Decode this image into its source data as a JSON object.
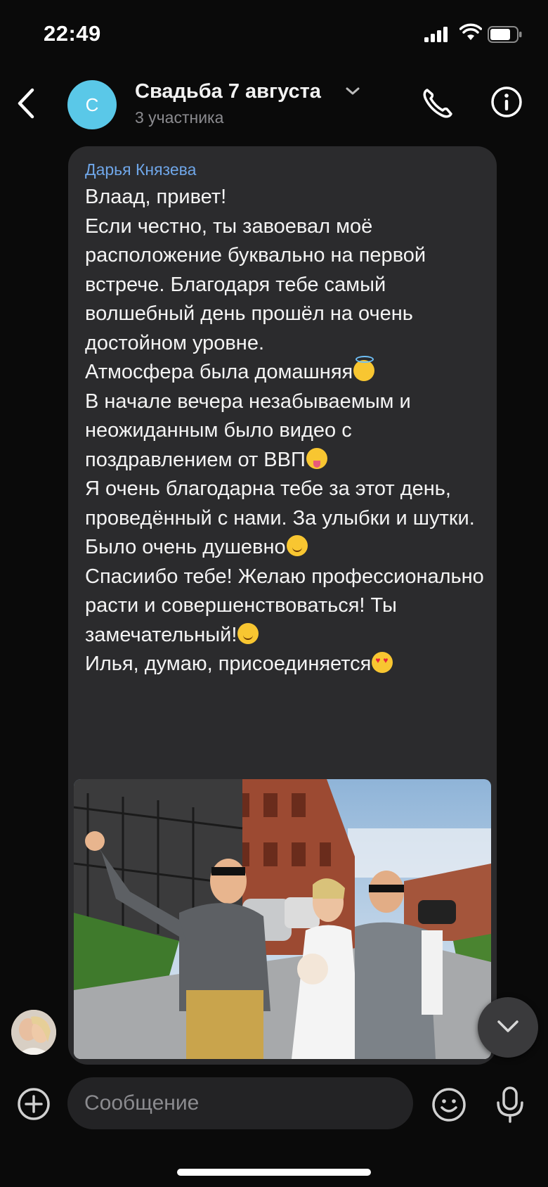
{
  "status_bar": {
    "time": "22:49"
  },
  "header": {
    "avatar_letter": "С",
    "title": "Свадьба 7 августа",
    "subtitle": "3 участника",
    "avatar_color": "#5ac8e8"
  },
  "message": {
    "sender": "Дарья Князева",
    "sender_color": "#6fa6e8",
    "lines": [
      "Влаад, привет!",
      "Если честно, ты завоевал моё расположение буквально на первой встрече. Благодаря тебе самый волшебный день прошёл на очень достойном уровне.",
      "Атмосфера была домашняя",
      "В начале вечера незабываемым и неожиданным было видео с поздравлением от ВВП",
      "Я очень благодарна тебе за этот день, проведённый с нами. За улыбки и шутки. Было очень душевно",
      "Спасиибо тебе! Желаю профессионально расти и совершенствоваться! Ты замечательный!",
      "Илья, думаю, присоединяется"
    ],
    "emojis": [
      "smiling-face-with-halo",
      "winking-face-with-tongue",
      "relieved-face",
      "smiling-face",
      "heart-eyes-face"
    ]
  },
  "composer": {
    "placeholder": "Сообщение"
  },
  "icons": {
    "back": "chevron-left-icon",
    "title_dropdown": "chevron-down-icon",
    "call": "phone-icon",
    "info": "info-icon",
    "attach": "plus-circle-icon",
    "emoji": "smiley-icon",
    "voice": "microphone-icon",
    "scroll": "chevron-down-icon"
  }
}
